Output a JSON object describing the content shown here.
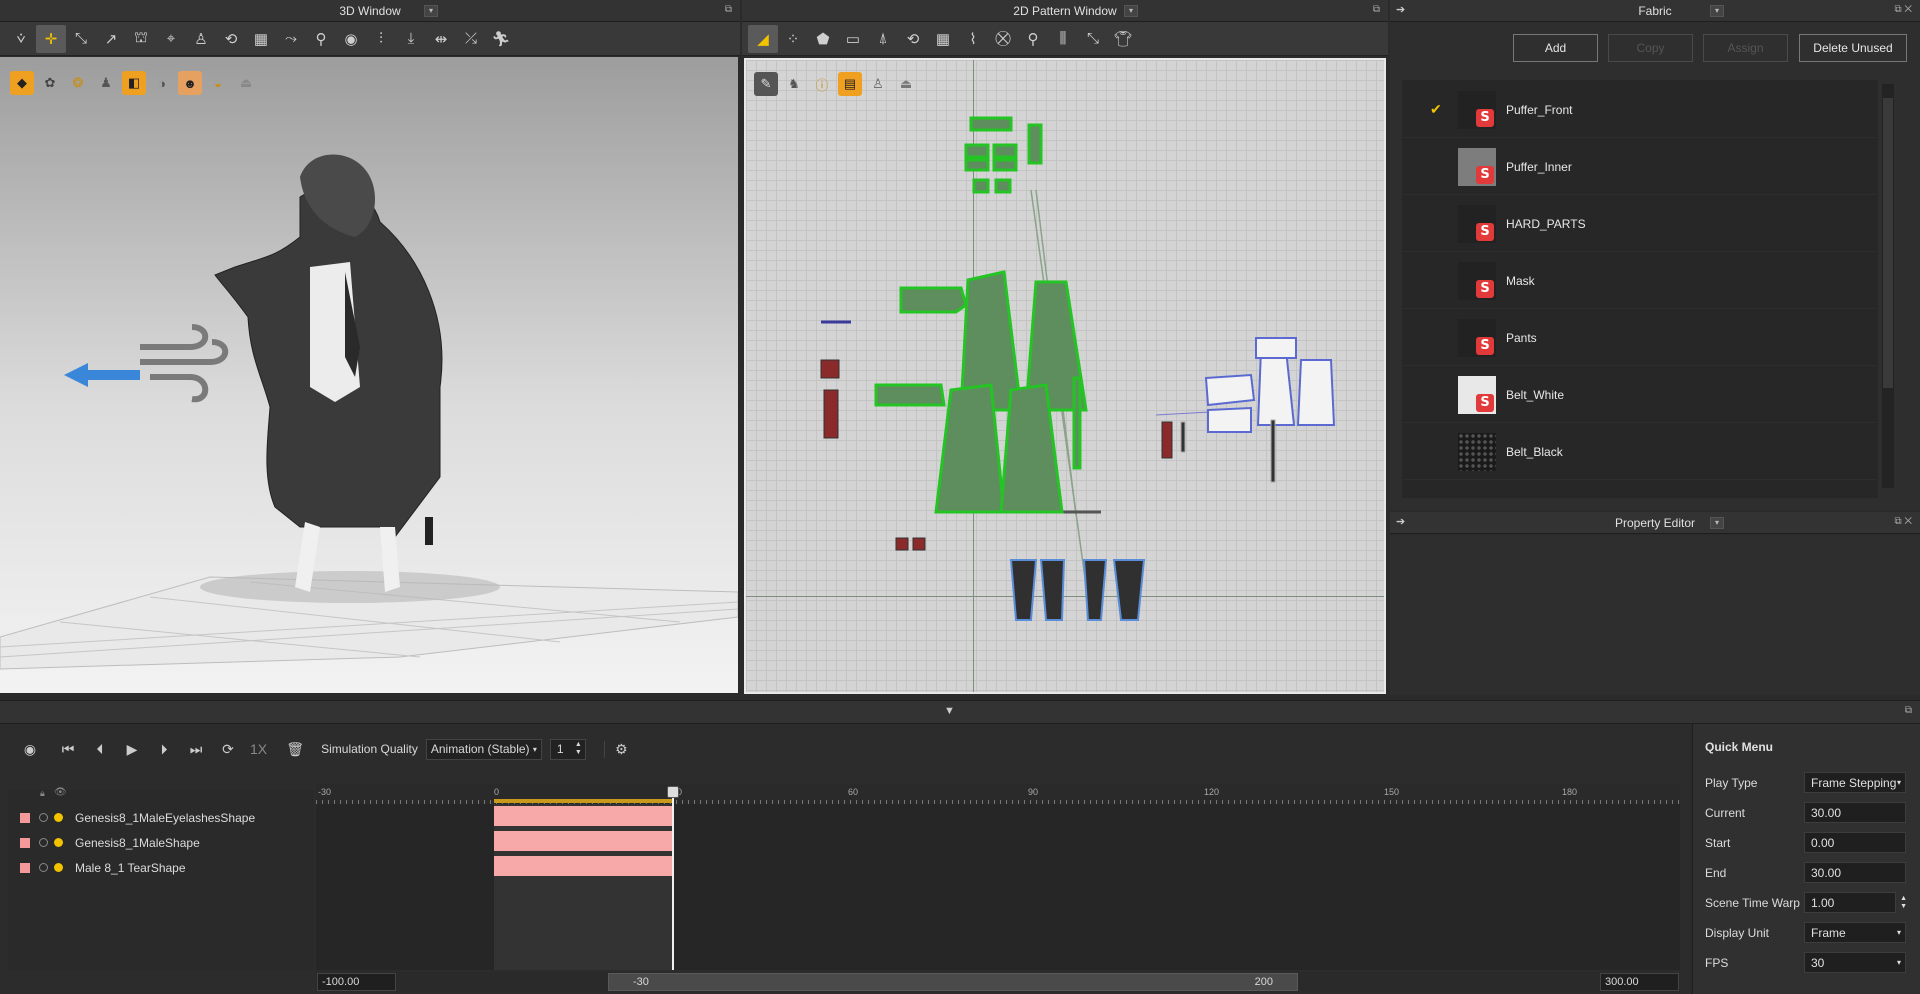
{
  "windows": {
    "w3d": "3D Window",
    "w2d": "2D Pattern Window",
    "fabric": "Fabric",
    "property": "Property Editor"
  },
  "fabric_buttons": {
    "add": "Add",
    "copy": "Copy",
    "assign": "Assign",
    "delete_unused": "Delete Unused"
  },
  "fabrics": [
    {
      "name": "Puffer_Front",
      "selected": true,
      "thumb": "dark"
    },
    {
      "name": "Puffer_Inner",
      "selected": false,
      "thumb": "gray"
    },
    {
      "name": "HARD_PARTS",
      "selected": false,
      "thumb": "dark"
    },
    {
      "name": "Mask",
      "selected": false,
      "thumb": "dark"
    },
    {
      "name": "Pants",
      "selected": false,
      "thumb": "dark"
    },
    {
      "name": "Belt_White",
      "selected": false,
      "thumb": "white"
    },
    {
      "name": "Belt_Black",
      "selected": false,
      "thumb": "pattern"
    }
  ],
  "timeline": {
    "speed": "1X",
    "sim_quality_label": "Simulation Quality",
    "sim_quality_value": "Animation (Stable)",
    "step_value": "1",
    "ruler_ticks": [
      "-30",
      "0",
      "30",
      "60",
      "90",
      "120",
      "150",
      "180"
    ],
    "tracks": [
      "Genesis8_1MaleEyelashesShape",
      "Genesis8_1MaleShape",
      "Male 8_1 TearShape"
    ],
    "range_left": "-100.00",
    "range_start": "-30",
    "range_end": "200",
    "range_right": "300.00"
  },
  "quick_menu": {
    "title": "Quick Menu",
    "rows": [
      {
        "label": "Play Type",
        "value": "Frame Stepping"
      },
      {
        "label": "Current",
        "value": "30.00"
      },
      {
        "label": "Start",
        "value": "0.00"
      },
      {
        "label": "End",
        "value": "30.00"
      },
      {
        "label": "Scene Time Warp",
        "value": "1.00"
      },
      {
        "label": "Display Unit",
        "value": "Frame"
      },
      {
        "label": "FPS",
        "value": "30"
      }
    ]
  },
  "colors": {
    "accent": "#f3c300",
    "track": "#f59a9a",
    "pattern_green": "#2fc12f"
  }
}
